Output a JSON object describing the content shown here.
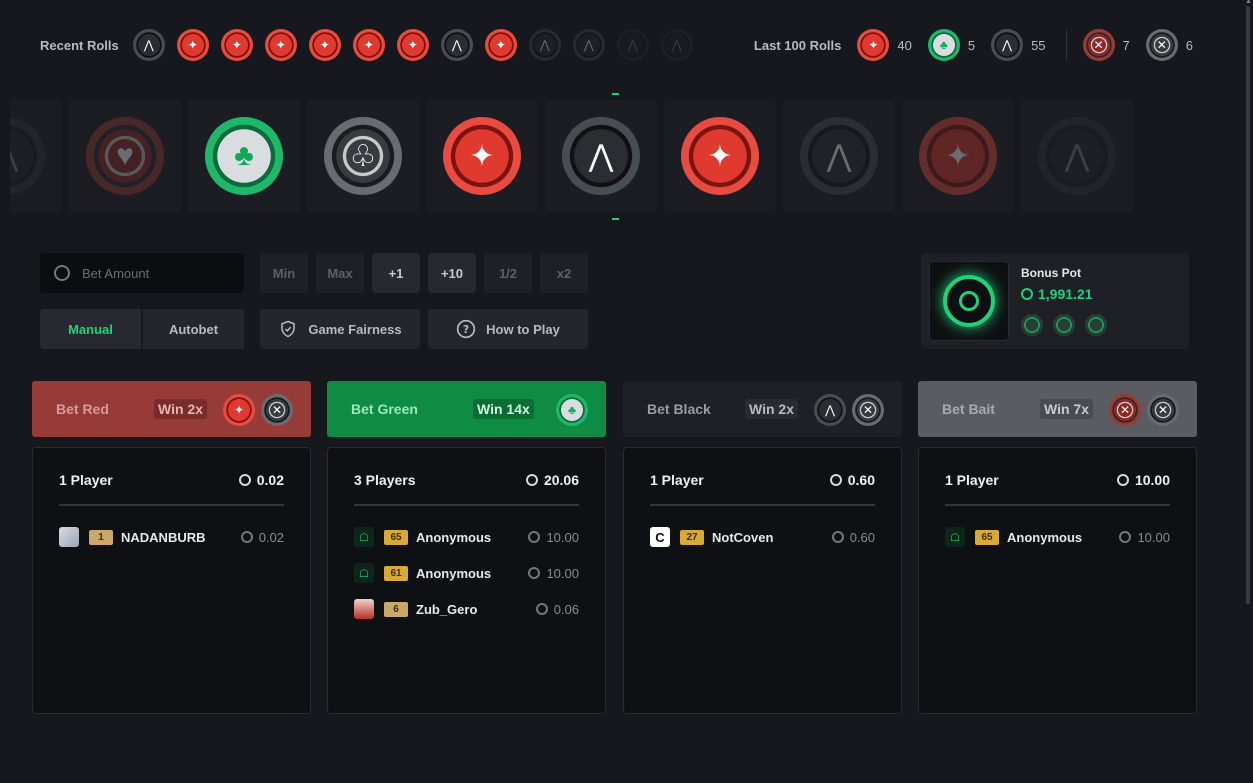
{
  "recent_rolls": {
    "label": "Recent Rolls",
    "chips": [
      {
        "type": "black",
        "icon": "wings-icon"
      },
      {
        "type": "red",
        "icon": "star-swords-icon"
      },
      {
        "type": "red",
        "icon": "star-swords-icon"
      },
      {
        "type": "red",
        "icon": "star-swords-icon"
      },
      {
        "type": "red",
        "icon": "star-swords-icon"
      },
      {
        "type": "red",
        "icon": "star-swords-icon"
      },
      {
        "type": "red",
        "icon": "star-swords-icon"
      },
      {
        "type": "black",
        "icon": "wings-icon"
      },
      {
        "type": "red",
        "icon": "star-swords-icon"
      },
      {
        "type": "black",
        "icon": "wings-icon"
      },
      {
        "type": "black",
        "icon": "wings-icon"
      },
      {
        "type": "black",
        "icon": "wings-icon"
      },
      {
        "type": "black",
        "icon": "wings-icon"
      }
    ]
  },
  "last100": {
    "label": "Last 100 Rolls",
    "red": "40",
    "green": "5",
    "black": "55",
    "bait_red": "7",
    "bait_black": "6"
  },
  "strip": [
    {
      "type": "black",
      "icon": "wings-icon",
      "fade": 2
    },
    {
      "type": "bait-red",
      "icon": "hearts-icon",
      "fade": 1
    },
    {
      "type": "green",
      "icon": "clover-icon",
      "fade": 0
    },
    {
      "type": "bait-black",
      "icon": "clover-outline-icon",
      "fade": 0
    },
    {
      "type": "red",
      "icon": "star-swords-icon",
      "fade": 0
    },
    {
      "type": "black",
      "icon": "wings-icon",
      "fade": 0
    },
    {
      "type": "red",
      "icon": "star-swords-icon",
      "fade": 0
    },
    {
      "type": "black",
      "icon": "wings-icon",
      "fade": 1
    },
    {
      "type": "red",
      "icon": "star-swords-icon",
      "fade": 1
    },
    {
      "type": "black",
      "icon": "wings-icon",
      "fade": 2
    }
  ],
  "bet_input": {
    "placeholder": "Bet Amount"
  },
  "quick_buttons": {
    "min": "Min",
    "max": "Max",
    "plus1": "+1",
    "plus10": "+10",
    "half": "1/2",
    "double": "x2"
  },
  "modes": {
    "manual": "Manual",
    "autobet": "Autobet"
  },
  "info_buttons": {
    "fairness": "Game Fairness",
    "howto": "How to Play"
  },
  "bonus_pot": {
    "title": "Bonus Pot",
    "value": "1,991.21"
  },
  "bets": {
    "red": {
      "label": "Bet Red",
      "win": "Win 2x",
      "players": "1 Player",
      "total": "0.02",
      "rows": [
        {
          "level": "1",
          "name": "NADANBURB",
          "amount": "0.02",
          "avatar": "img"
        }
      ]
    },
    "green": {
      "label": "Bet Green",
      "win": "Win 14x",
      "players": "3 Players",
      "total": "20.06",
      "rows": [
        {
          "level": "65",
          "name": "Anonymous",
          "amount": "10.00",
          "avatar": "ghost"
        },
        {
          "level": "61",
          "name": "Anonymous",
          "amount": "10.00",
          "avatar": "ghost"
        },
        {
          "level": "6",
          "name": "Zub_Gero",
          "amount": "0.06",
          "avatar": "zub"
        }
      ]
    },
    "black": {
      "label": "Bet Black",
      "win": "Win 2x",
      "players": "1 Player",
      "total": "0.60",
      "rows": [
        {
          "level": "27",
          "name": "NotCoven",
          "amount": "0.60",
          "avatar": "cv",
          "avatar_text": "C"
        }
      ]
    },
    "bait": {
      "label": "Bet Bait",
      "win": "Win 7x",
      "players": "1 Player",
      "total": "10.00",
      "rows": [
        {
          "level": "65",
          "name": "Anonymous",
          "amount": "10.00",
          "avatar": "ghost"
        }
      ]
    }
  }
}
